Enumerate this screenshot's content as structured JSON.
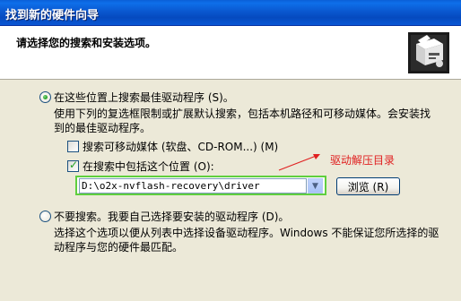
{
  "window": {
    "title": "找到新的硬件向导"
  },
  "header": {
    "heading": "请选择您的搜索和安装选项。",
    "icon": "hardware-wizard-icon"
  },
  "option_search": {
    "label": "在这些位置上搜索最佳驱动程序 (S)。",
    "description_line1": "使用下列的复选框限制或扩展默认搜索，包括本机路径和可移动媒体。会安装找",
    "description_line2": "到的最佳驱动程序。",
    "checked": true
  },
  "checkbox_removable": {
    "label": "搜索可移动媒体 (软盘、CD-ROM...) (M)",
    "checked": false
  },
  "checkbox_location": {
    "label": "在搜索中包括这个位置 (O):",
    "checked": true
  },
  "location_combo": {
    "value": "D:\\o2x-nvflash-recovery\\driver"
  },
  "browse_button": {
    "label": "浏览 (R)"
  },
  "option_manual": {
    "label": "不要搜索。我要自己选择要安装的驱动程序 (D)。",
    "description_line1": "选择这个选项以便从列表中选择设备驱动程序。Windows 不能保证您所选择的驱",
    "description_line2": "动程序与您的硬件最匹配。",
    "checked": false
  },
  "annotation": {
    "text": "驱动解压目录",
    "color": "#e02020"
  },
  "colors": {
    "title_bar": "#0A58D0",
    "dialog_bg": "#ECE9D8",
    "highlight_border": "#5fcf3e"
  }
}
